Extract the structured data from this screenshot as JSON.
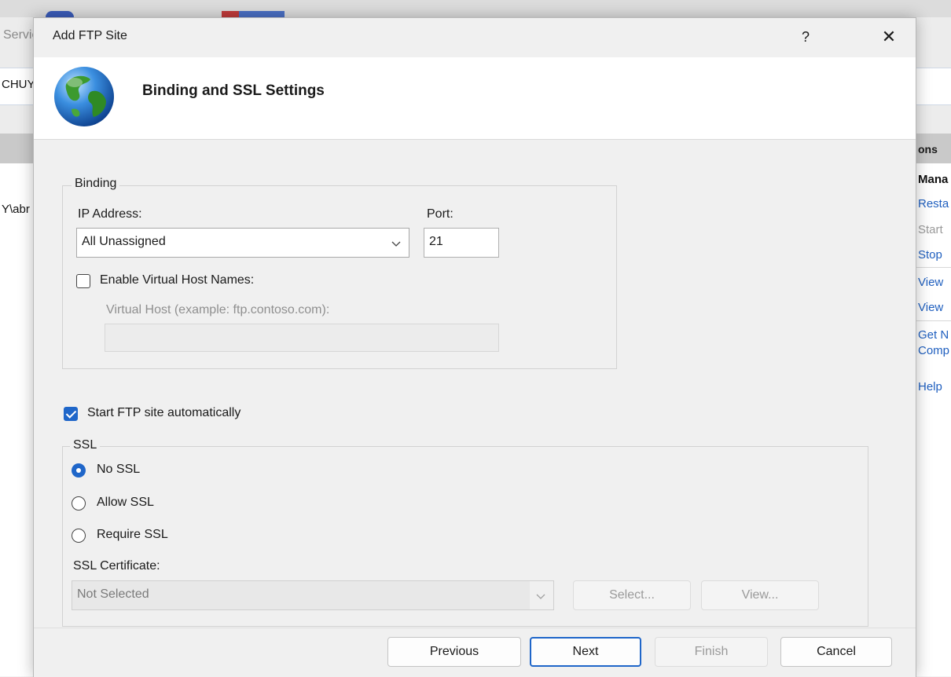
{
  "background": {
    "left_title_fragment": "Servic",
    "left_address_fragment": "CHUY",
    "left_list_fragment": "Y\\abr",
    "actions_header_fragment": "ons",
    "actions": [
      {
        "label": "Mana",
        "style": "bold"
      },
      {
        "label": "Resta",
        "style": "link"
      },
      {
        "label": "Start",
        "style": "disabled"
      },
      {
        "label": "Stop",
        "style": "link"
      },
      {
        "label": "View",
        "style": "link"
      },
      {
        "label": "View",
        "style": "link"
      },
      {
        "label": "Get N",
        "style": "link"
      },
      {
        "label": "Comp",
        "style": "link"
      },
      {
        "label": "Help",
        "style": "link"
      }
    ]
  },
  "dialog": {
    "title": "Add FTP Site",
    "help_glyph": "?",
    "close_glyph": "✕",
    "banner_title": "Binding and SSL Settings",
    "banner_icon": "globe-icon",
    "binding": {
      "legend": "Binding",
      "ip_label": "IP Address:",
      "ip_value": "All Unassigned",
      "port_label": "Port:",
      "port_value": "21",
      "virtual_host_checkbox_label": "Enable Virtual Host Names:",
      "virtual_host_checked": false,
      "virtual_host_label": "Virtual Host (example: ftp.contoso.com):",
      "virtual_host_value": ""
    },
    "start_automatically_label": "Start FTP site automatically",
    "start_automatically_checked": true,
    "ssl": {
      "legend": "SSL",
      "options": [
        {
          "label": "No SSL",
          "selected": true
        },
        {
          "label": "Allow SSL",
          "selected": false
        },
        {
          "label": "Require SSL",
          "selected": false
        }
      ],
      "certificate_label": "SSL Certificate:",
      "certificate_value": "Not Selected",
      "select_button": "Select...",
      "view_button": "View..."
    },
    "buttons": {
      "previous": "Previous",
      "next": "Next",
      "finish": "Finish",
      "cancel": "Cancel"
    },
    "colors": {
      "accent": "#1f66c9",
      "link": "#1f5fbf"
    }
  }
}
